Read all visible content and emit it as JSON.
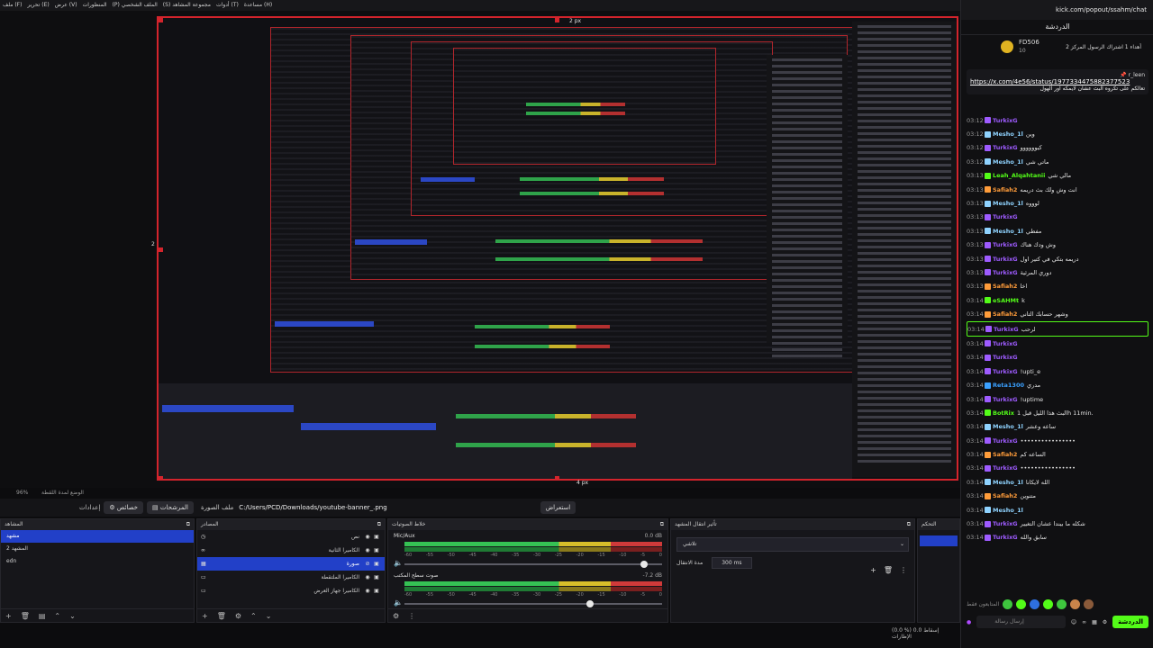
{
  "menu": [
    "(F) ملف",
    "(E) تحرير",
    "(V) عرض",
    "الملف الشخصي (P)",
    "مجموعة المشاهد (S)",
    "(T) أدوات",
    "(H) مساعدة",
    "المنظورات"
  ],
  "preview": {
    "dim_top": "2 px",
    "dim_left": "2 px",
    "dim_right": "4 px"
  },
  "zoom": {
    "value": "96%",
    "label": "الوضع لمدة اللقطة"
  },
  "toolbar": {
    "properties_label": "خصائص",
    "filters_label": "المرشحات",
    "settings_label": "إعدادات",
    "image_file_label": "ملف الصورة",
    "image_path": "C:/Users/PCD/Downloads/youtube-banner_.png",
    "browse_label": "استعراض"
  },
  "scenes": {
    "title": "المشاهد",
    "items": [
      "مشهد",
      "المشهد 2",
      "edn"
    ],
    "selected": 0
  },
  "sources": {
    "title": "المصادر",
    "items": [
      {
        "name": "نص"
      },
      {
        "name": "الكاميرا الثانية"
      },
      {
        "name": "صورة"
      },
      {
        "name": "الكاميرا الملتقطة"
      },
      {
        "name": "الكاميرا جهاز العرض"
      }
    ],
    "selected": 2
  },
  "mixer": {
    "title": "خلاط الصوتيات",
    "channels": [
      {
        "name": "Mic/Aux",
        "db": "0.0 dB",
        "level": 0.0,
        "fader": 0.93
      },
      {
        "name": "صوت سطح المكتب",
        "db": "-7.2 dB",
        "level": 0.0,
        "fader": 0.72
      }
    ],
    "scale": [
      "-60",
      "-55",
      "-50",
      "-45",
      "-40",
      "-35",
      "-30",
      "-25",
      "-20",
      "-15",
      "-10",
      "-5",
      "0"
    ]
  },
  "transitions": {
    "title": "تأثير انتقال المشهد",
    "type": "تلاشي",
    "duration_label": "مدة الانتقال",
    "duration_value": "300 ms"
  },
  "controls": {
    "title": "التحكم"
  },
  "status": {
    "cpu": "(0.0 %) 0.0 إسقاط الإطارات",
    "live": ""
  },
  "chat": {
    "url": "kick.com/popout/ssahm/chat",
    "header": "الدردشة",
    "pinned": {
      "user": "FD506",
      "count": "10",
      "text": "أهداء 1 اشتراك الرسول المركز 2"
    },
    "reply_user": "r_leen",
    "reply_link": "https://x.com/4e56/status/1977334475882377523",
    "reply_text": "تعالكم على تكروه البث عشان لايمكه اور الهول",
    "messages": [
      {
        "t": "03:12",
        "u": "TurkixG",
        "c": "#9e5bff",
        "txt": ""
      },
      {
        "t": "03:12",
        "u": "Mesho_1l",
        "c": "#8fd3ff",
        "txt": "وين"
      },
      {
        "t": "03:12",
        "u": "TurkixG",
        "c": "#9e5bff",
        "txt": "كيوووووو"
      },
      {
        "t": "03:12",
        "u": "Mesho_1l",
        "c": "#8fd3ff",
        "txt": "ماتي شي"
      },
      {
        "t": "03:13",
        "u": "Leah_Alqahtanii",
        "c": "#53fc18",
        "txt": "مالي شي"
      },
      {
        "t": "03:13",
        "u": "Safiah2",
        "c": "#ff9c3a",
        "txt": "انت وش ولك بث دريمه"
      },
      {
        "t": "03:13",
        "u": "Mesho_1l",
        "c": "#8fd3ff",
        "txt": "لوووه"
      },
      {
        "t": "03:13",
        "u": "TurkixG",
        "c": "#9e5bff",
        "txt": ""
      },
      {
        "t": "03:13",
        "u": "Mesho_1l",
        "c": "#8fd3ff",
        "txt": "مفطي"
      },
      {
        "t": "03:13",
        "u": "TurkixG",
        "c": "#9e5bff",
        "txt": "وش ودك هناك"
      },
      {
        "t": "03:13",
        "u": "TurkixG",
        "c": "#9e5bff",
        "txt": "دريمه بتكي في كتير اول"
      },
      {
        "t": "03:13",
        "u": "TurkixG",
        "c": "#9e5bff",
        "txt": "دوري المرئية"
      },
      {
        "t": "03:13",
        "u": "Safiah2",
        "c": "#ff9c3a",
        "txt": "اخا"
      },
      {
        "t": "03:14",
        "u": "eSAHMt",
        "c": "#53fc18",
        "txt": "k"
      },
      {
        "t": "03:14",
        "u": "Safiah2",
        "c": "#ff9c3a",
        "txt": "وشهر حسابك التاني"
      },
      {
        "t": "03:14",
        "u": "TurkixG",
        "c": "#9e5bff",
        "txt": "لرحب",
        "hl": true
      },
      {
        "t": "03:14",
        "u": "TurkixG",
        "c": "#9e5bff",
        "txt": ""
      },
      {
        "t": "03:14",
        "u": "TurkixG",
        "c": "#9e5bff",
        "txt": ""
      },
      {
        "t": "03:14",
        "u": "TurkixG",
        "c": "#9e5bff",
        "txt": "!upti_e"
      },
      {
        "t": "03:14",
        "u": "Reta1300",
        "c": "#3aa0ff",
        "txt": "مدري"
      },
      {
        "t": "03:14",
        "u": "TurkixG",
        "c": "#9e5bff",
        "txt": "!uptime"
      },
      {
        "t": "03:14",
        "u": "BotRix",
        "c": "#53fc18",
        "txt": "البث هذا الليل قبل 1h 11min."
      },
      {
        "t": "03:14",
        "u": "Mesho_1l",
        "c": "#8fd3ff",
        "txt": "ساعه وعشر"
      },
      {
        "t": "03:14",
        "u": "TurkixG",
        "c": "#9e5bff",
        "txt": "••••••••••••••••"
      },
      {
        "t": "03:14",
        "u": "Safiah2",
        "c": "#ff9c3a",
        "txt": "الساعه كم"
      },
      {
        "t": "03:14",
        "u": "TurkixG",
        "c": "#9e5bff",
        "txt": "••••••••••••••••"
      },
      {
        "t": "03:14",
        "u": "Mesho_1l",
        "c": "#8fd3ff",
        "txt": "الله لايكانا"
      },
      {
        "t": "03:14",
        "u": "Safiah2",
        "c": "#ff9c3a",
        "txt": "متنوين"
      },
      {
        "t": "03:14",
        "u": "Mesho_1l",
        "c": "#8fd3ff",
        "txt": ""
      },
      {
        "t": "03:14",
        "u": "TurkixG",
        "c": "#9e5bff",
        "txt": "شكله ما بيندا عشان التغيير"
      },
      {
        "t": "03:14",
        "u": "TurkixG",
        "c": "#9e5bff",
        "txt": "سابق والله"
      }
    ],
    "emote_label": "المتابعون فقط",
    "input_placeholder": "إرسال رسالة",
    "send_label": "الدردشة"
  },
  "colors": {
    "accent_red": "#d3242c",
    "selection_blue": "#2240c8",
    "kick_green": "#53fc18"
  }
}
